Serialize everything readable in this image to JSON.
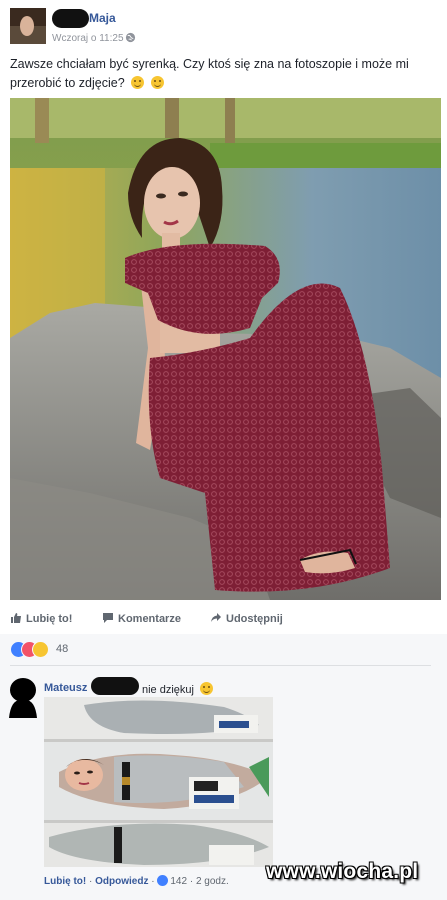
{
  "post": {
    "author": "Maja",
    "timestamp": "Wczoraj o 11:25",
    "text": "Zawsze chciałam być syrenką. Czy ktoś się zna na fotoszopie i może mi przerobić to zdjęcie?",
    "image_description_icon": "photo"
  },
  "actions": {
    "like": "Lubię to!",
    "comment": "Komentarze",
    "share": "Udostępnij"
  },
  "reactions": {
    "types": [
      "like-icon",
      "love-icon",
      "haha-icon"
    ],
    "count": "48"
  },
  "comment": {
    "author": "Mateusz",
    "text": "nie dziękuj",
    "like_label": "Lubię to!",
    "separator1": "·",
    "reply_label": "Odpowiedz",
    "separator2": "·",
    "like_count": "142",
    "separator3": "·",
    "time": "2 godz."
  },
  "watermark": "www.wiocha.pl",
  "colors": {
    "link": "#365899",
    "like_blue": "#4080ff",
    "love_red": "#f25268",
    "haha_yellow": "#f7c531",
    "feedback_bg": "#f6f7f9"
  }
}
